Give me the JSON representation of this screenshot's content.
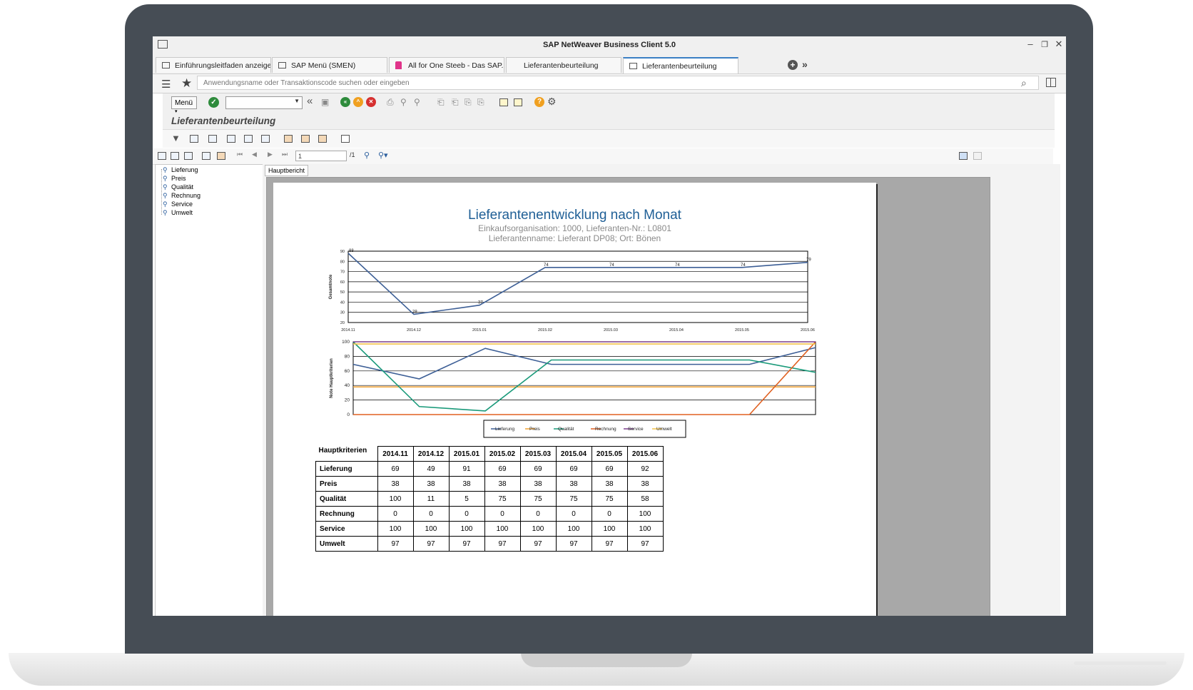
{
  "window": {
    "title": "SAP NetWeaver Business Client 5.0"
  },
  "tabs": [
    {
      "label": "Einführungsleitfaden anzeigen",
      "icon": "doc-icon"
    },
    {
      "label": "SAP Menü (SMEN)",
      "icon": "doc-icon"
    },
    {
      "label": "All for One Steeb - Das SAP...",
      "icon": "bag-icon"
    },
    {
      "label": "Lieferantenbeurteilung",
      "icon": ""
    },
    {
      "label": "Lieferantenbeurteilung",
      "icon": "doc-icon",
      "active": true
    }
  ],
  "search": {
    "placeholder": "Anwendungsname oder Transaktionscode suchen oder eingeben"
  },
  "toolbar": {
    "menu_label": "Menü"
  },
  "app": {
    "title": "Lieferantenbeurteilung"
  },
  "pager": {
    "page": "1",
    "total": "/1"
  },
  "tree": {
    "items": [
      "Lieferung",
      "Preis",
      "Qualität",
      "Rechnung",
      "Service",
      "Umwelt"
    ]
  },
  "report": {
    "tab_label": "Hauptbericht",
    "title": "Lieferantenentwicklung nach Monat",
    "subtitle1": "Einkaufsorganisation: 1000, Lieferanten-Nr.: L0801",
    "subtitle2": "Lieferantenname: Lieferant DP08; Ort: Bönen"
  },
  "chart_data": [
    {
      "type": "line",
      "ylabel": "Gesamtnote",
      "categories": [
        "2014.11",
        "2014.12",
        "2015.01",
        "2015.02",
        "2015.03",
        "2015.04",
        "2015.05",
        "2015.06"
      ],
      "ylim": [
        20,
        90
      ],
      "yticks": [
        20,
        30,
        40,
        50,
        60,
        70,
        80,
        90
      ],
      "grid": true,
      "series": [
        {
          "values": [
            88,
            28,
            37,
            74,
            74,
            74,
            74,
            79
          ],
          "color": "#3d5f96"
        }
      ],
      "data_labels": [
        "88",
        "28",
        "37",
        "74",
        "74",
        "74",
        "74",
        "79"
      ]
    },
    {
      "type": "line",
      "ylabel": "Note Hauptkriterien",
      "categories": [
        "2014.11",
        "2014.12",
        "2015.01",
        "2015.02",
        "2015.03",
        "2015.04",
        "2015.05",
        "2015.06"
      ],
      "ylim": [
        0,
        100
      ],
      "yticks": [
        0,
        20,
        40,
        60,
        80,
        100
      ],
      "grid": true,
      "legend": "bottom",
      "series": [
        {
          "name": "Lieferung",
          "values": [
            69,
            49,
            91,
            69,
            69,
            69,
            69,
            92
          ],
          "color": "#3d5f96"
        },
        {
          "name": "Preis",
          "values": [
            38,
            38,
            38,
            38,
            38,
            38,
            38,
            38
          ],
          "color": "#f0a030"
        },
        {
          "name": "Qualität",
          "values": [
            100,
            11,
            5,
            75,
            75,
            75,
            75,
            58
          ],
          "color": "#1a9a7a"
        },
        {
          "name": "Rechnung",
          "values": [
            0,
            0,
            0,
            0,
            0,
            0,
            0,
            100
          ],
          "color": "#e06020"
        },
        {
          "name": "Service",
          "values": [
            100,
            100,
            100,
            100,
            100,
            100,
            100,
            100
          ],
          "color": "#7b3f8c"
        },
        {
          "name": "Umwelt",
          "values": [
            97,
            97,
            97,
            97,
            97,
            97,
            97,
            97
          ],
          "color": "#f2c24a"
        }
      ]
    },
    {
      "type": "table",
      "corner": "Hauptkriterien",
      "columns": [
        "2014.11",
        "2014.12",
        "2015.01",
        "2015.02",
        "2015.03",
        "2015.04",
        "2015.05",
        "2015.06"
      ],
      "rows": [
        {
          "label": "Lieferung",
          "values": [
            "69",
            "49",
            "91",
            "69",
            "69",
            "69",
            "69",
            "92"
          ]
        },
        {
          "label": "Preis",
          "values": [
            "38",
            "38",
            "38",
            "38",
            "38",
            "38",
            "38",
            "38"
          ]
        },
        {
          "label": "Qualität",
          "values": [
            "100",
            "11",
            "5",
            "75",
            "75",
            "75",
            "75",
            "58"
          ]
        },
        {
          "label": "Rechnung",
          "values": [
            "0",
            "0",
            "0",
            "0",
            "0",
            "0",
            "0",
            "100"
          ]
        },
        {
          "label": "Service",
          "values": [
            "100",
            "100",
            "100",
            "100",
            "100",
            "100",
            "100",
            "100"
          ]
        },
        {
          "label": "Umwelt",
          "values": [
            "97",
            "97",
            "97",
            "97",
            "97",
            "97",
            "97",
            "97"
          ]
        }
      ]
    }
  ]
}
